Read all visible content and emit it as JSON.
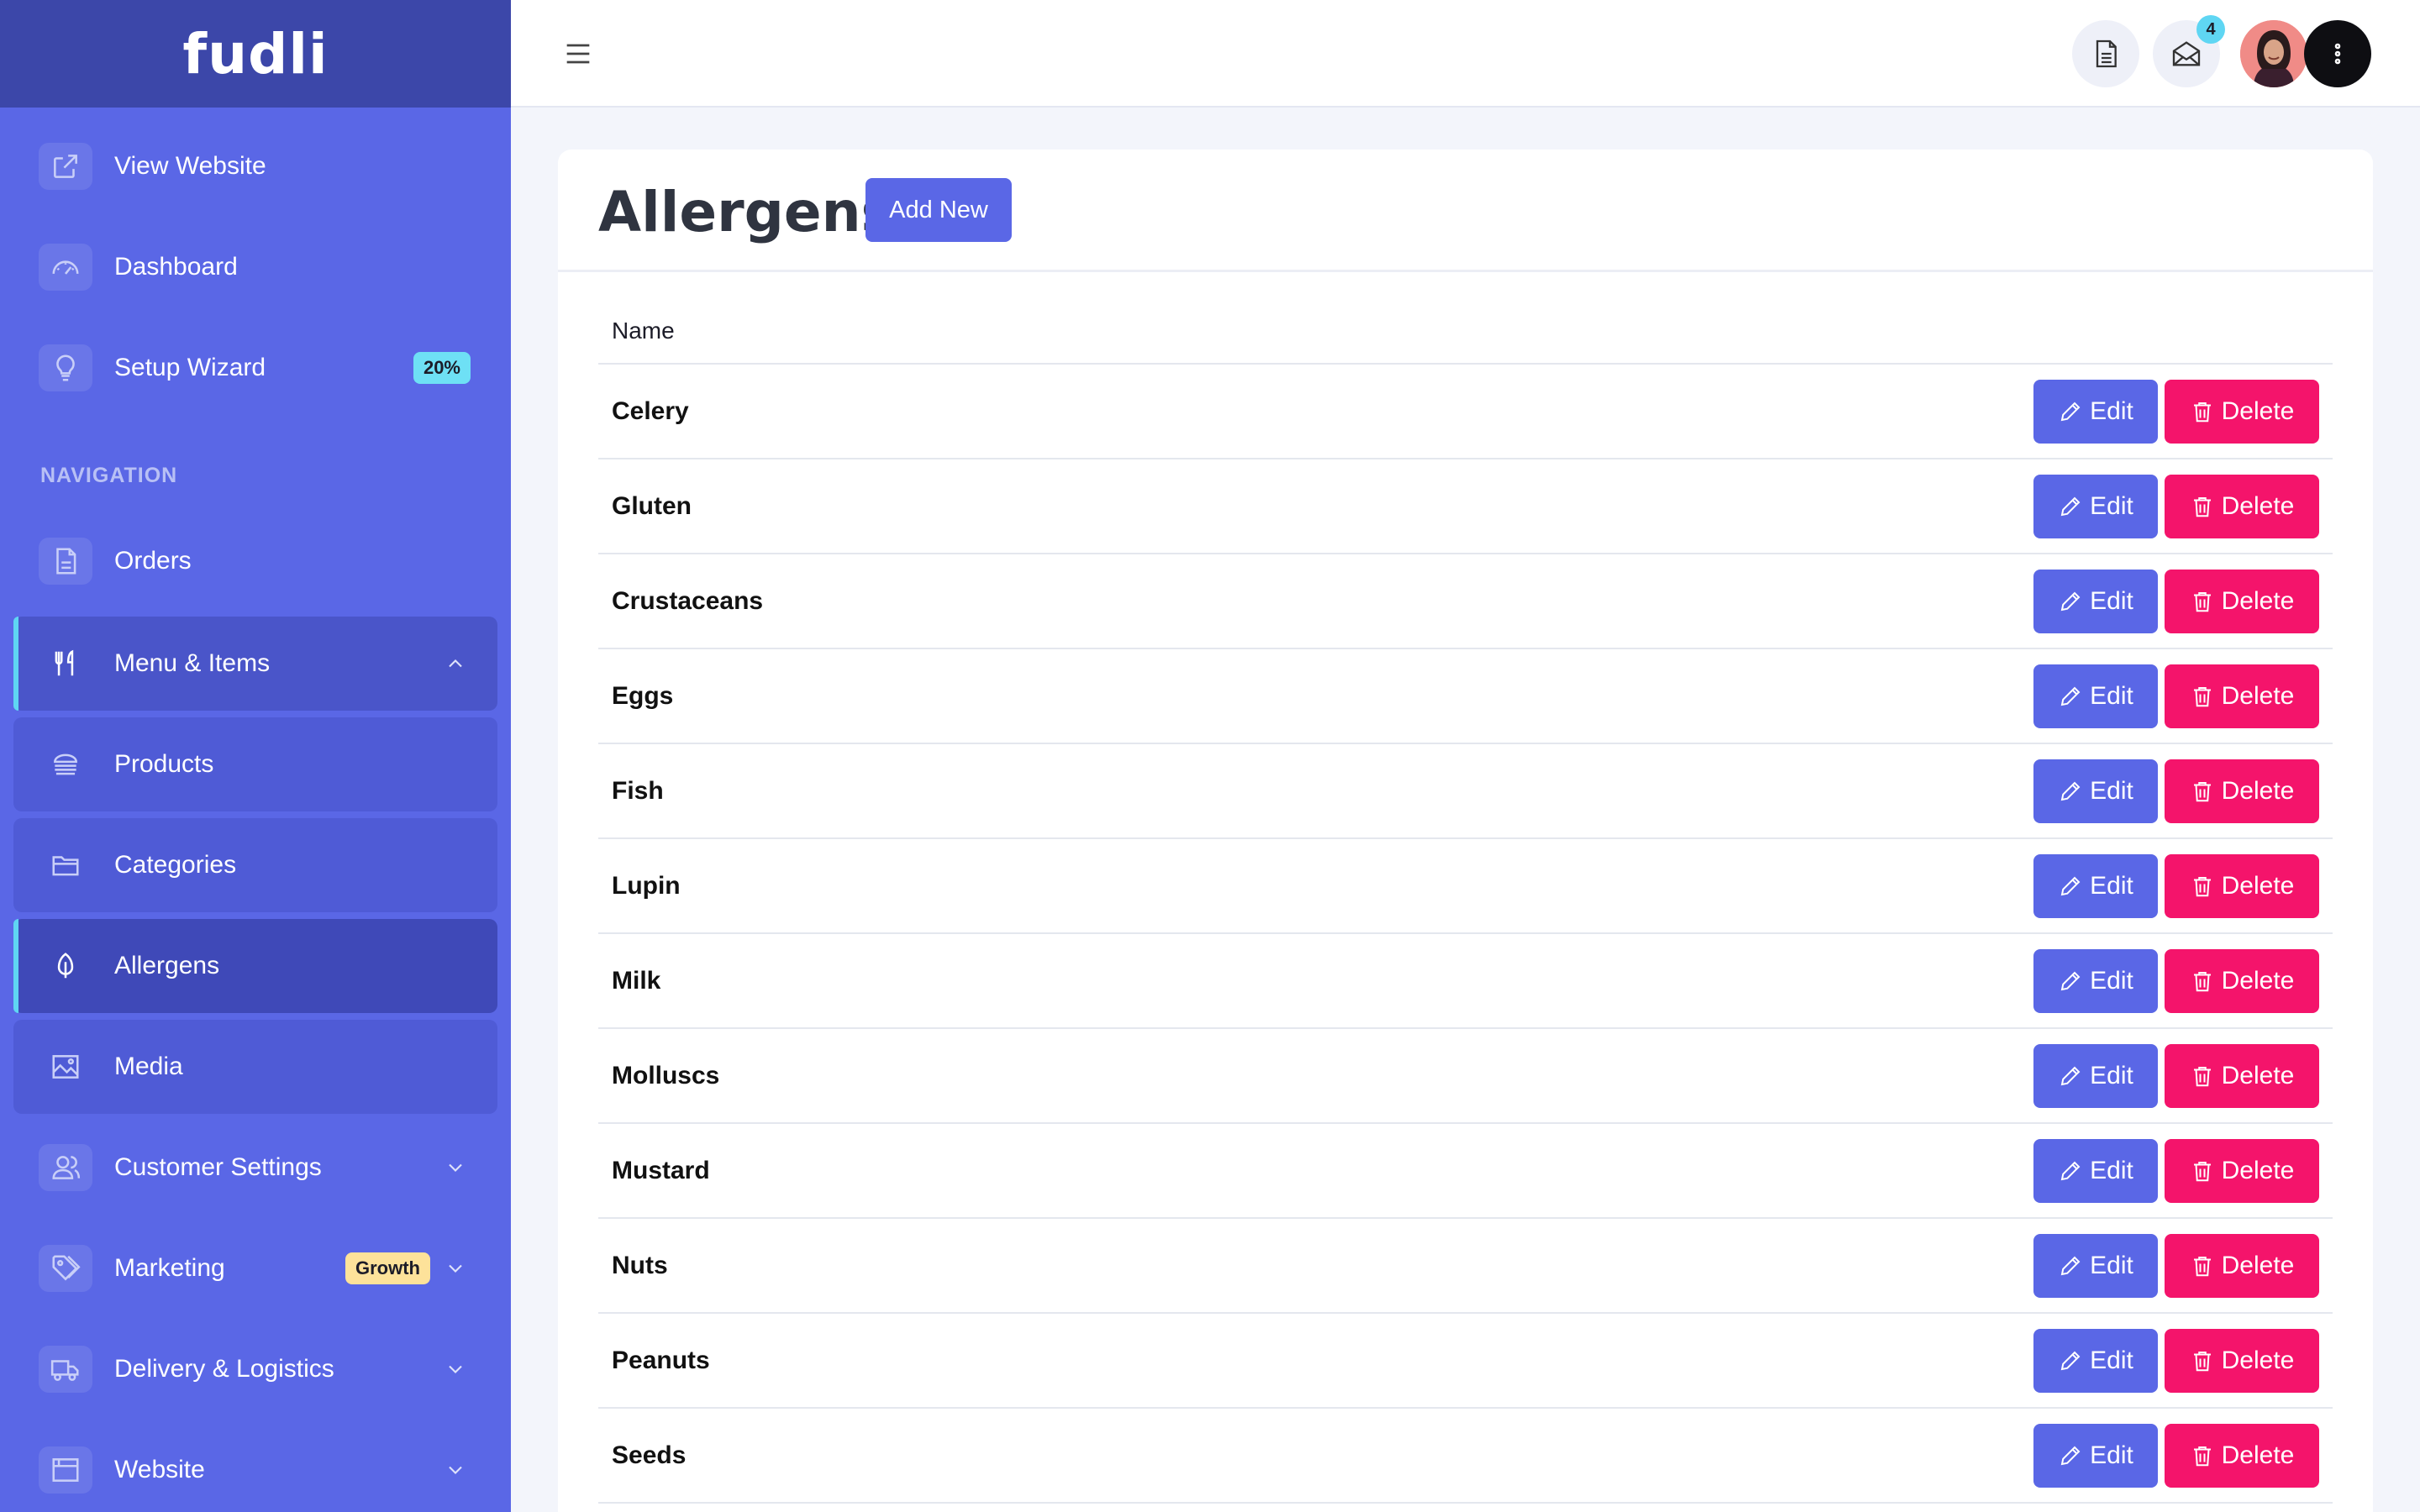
{
  "brand": {
    "logo": "fudli"
  },
  "sidebar": {
    "section_label": "NAVIGATION",
    "top_items": [
      {
        "label": "View Website",
        "icon": "external-link-icon"
      },
      {
        "label": "Dashboard",
        "icon": "gauge-icon"
      },
      {
        "label": "Setup Wizard",
        "icon": "lightbulb-icon",
        "badge": "20%"
      }
    ],
    "nav_items": [
      {
        "label": "Orders",
        "icon": "document-icon"
      },
      {
        "label": "Menu & Items",
        "icon": "fork-knife-icon",
        "expanded": true
      },
      {
        "label": "Products",
        "icon": "burger-icon"
      },
      {
        "label": "Categories",
        "icon": "folder-icon"
      },
      {
        "label": "Allergens",
        "icon": "leaf-icon",
        "active": true
      },
      {
        "label": "Media",
        "icon": "image-icon"
      },
      {
        "label": "Customer Settings",
        "icon": "users-icon"
      },
      {
        "label": "Marketing",
        "icon": "tag-icon",
        "badge": "Growth"
      },
      {
        "label": "Delivery & Logistics",
        "icon": "truck-icon"
      },
      {
        "label": "Website",
        "icon": "browser-icon"
      }
    ]
  },
  "topbar": {
    "notification_count": "4"
  },
  "page": {
    "title": "Allergens",
    "add_button": "Add New",
    "column_header": "Name",
    "edit_label": "Edit",
    "delete_label": "Delete",
    "rows": [
      "Celery",
      "Gluten",
      "Crustaceans",
      "Eggs",
      "Fish",
      "Lupin",
      "Milk",
      "Molluscs",
      "Mustard",
      "Nuts",
      "Peanuts",
      "Seeds"
    ]
  },
  "colors": {
    "sidebar": "#5a67e6",
    "logo_bar": "#3c47a9",
    "primary": "#5a67e6",
    "danger": "#f4146b",
    "accent": "#5fd6f3"
  }
}
